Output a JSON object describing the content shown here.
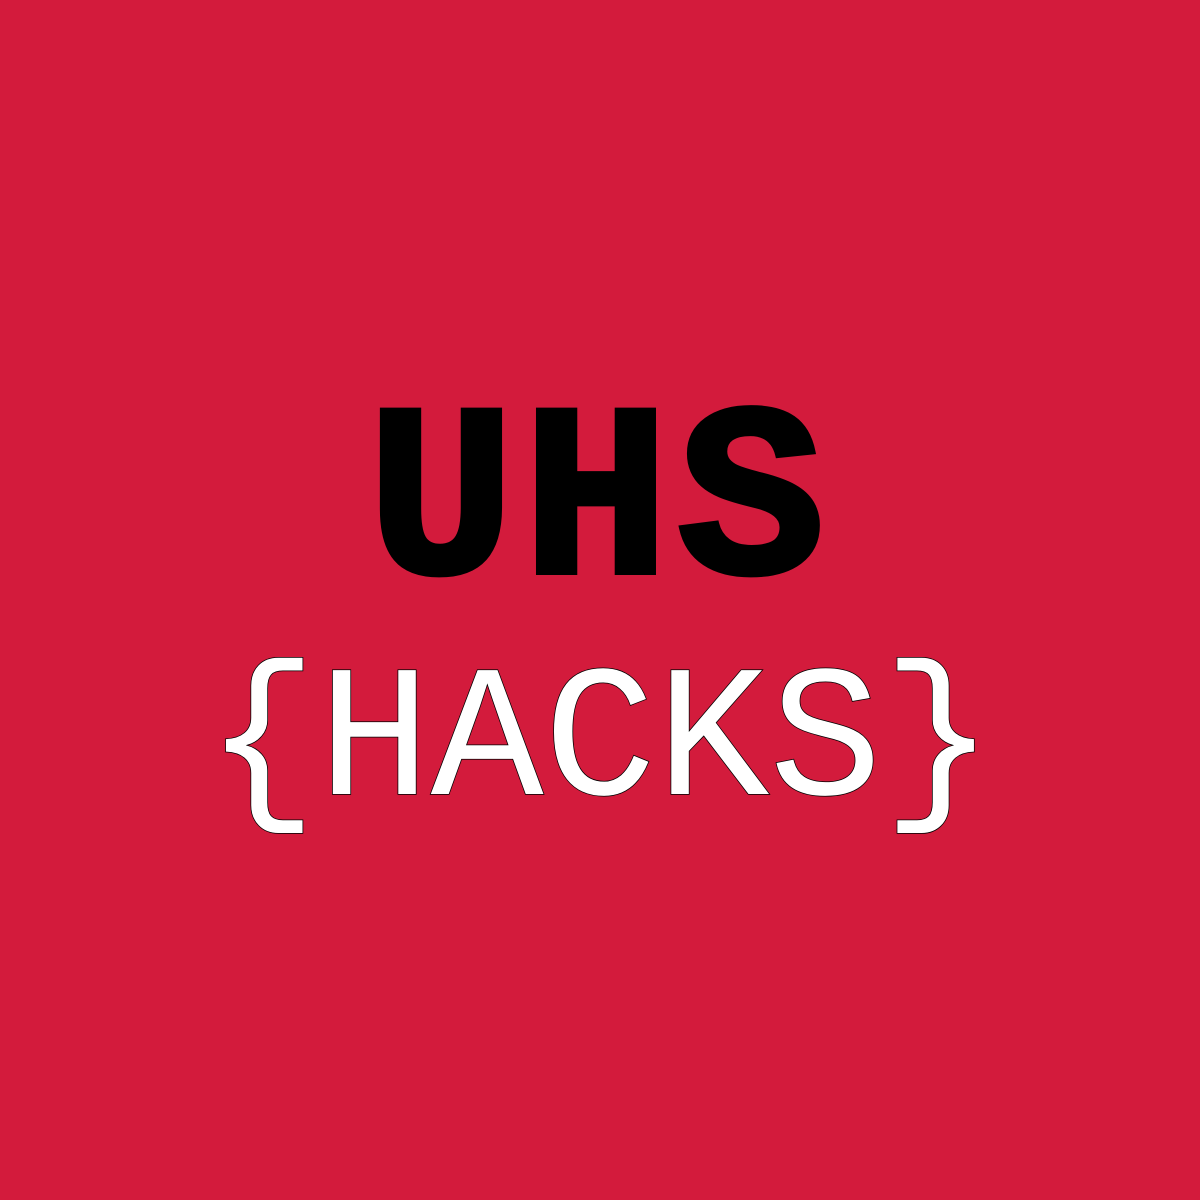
{
  "logo": {
    "title": "UHS",
    "subtitle_open": "{",
    "subtitle_word": "HACKS",
    "subtitle_close": "}"
  },
  "colors": {
    "background": "#d31b3c",
    "title": "#000000",
    "subtitle": "#ffffff"
  }
}
